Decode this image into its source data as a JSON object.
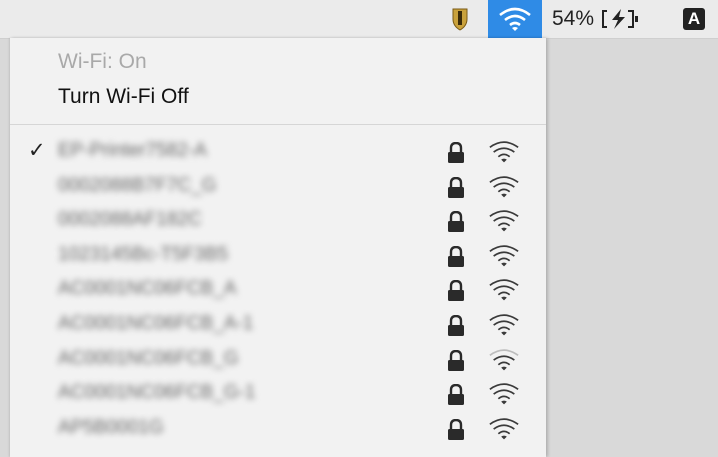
{
  "menubar": {
    "battery_percent": "54%",
    "input_source_letter": "A",
    "icons": [
      "security-shield-icon",
      "wifi-icon",
      "battery-charging-icon",
      "input-source-icon"
    ],
    "active_color": "#2f8be6",
    "shield_color": "#c9a13b"
  },
  "wifi_menu": {
    "status": "Wi-Fi: On",
    "toggle_label": "Turn Wi-Fi Off",
    "networks": [
      {
        "name": "EP-Printer7582-A",
        "selected": true,
        "secured": true,
        "signal": 4
      },
      {
        "name": "0002088B7F7C_G",
        "selected": false,
        "secured": true,
        "signal": 4
      },
      {
        "name": "0002088AF182C",
        "selected": false,
        "secured": true,
        "signal": 4
      },
      {
        "name": "1023145Bc-T5F3B5",
        "selected": false,
        "secured": true,
        "signal": 4
      },
      {
        "name": "AC0001NC06FCB_A",
        "selected": false,
        "secured": true,
        "signal": 4
      },
      {
        "name": "AC0001NC06FCB_A-1",
        "selected": false,
        "secured": true,
        "signal": 4
      },
      {
        "name": "AC0001NC06FCB_G",
        "selected": false,
        "secured": true,
        "signal": 3
      },
      {
        "name": "AC0001NC06FCB_G-1",
        "selected": false,
        "secured": true,
        "signal": 4
      },
      {
        "name": "AP5B0001G",
        "selected": false,
        "secured": true,
        "signal": 4
      }
    ]
  }
}
